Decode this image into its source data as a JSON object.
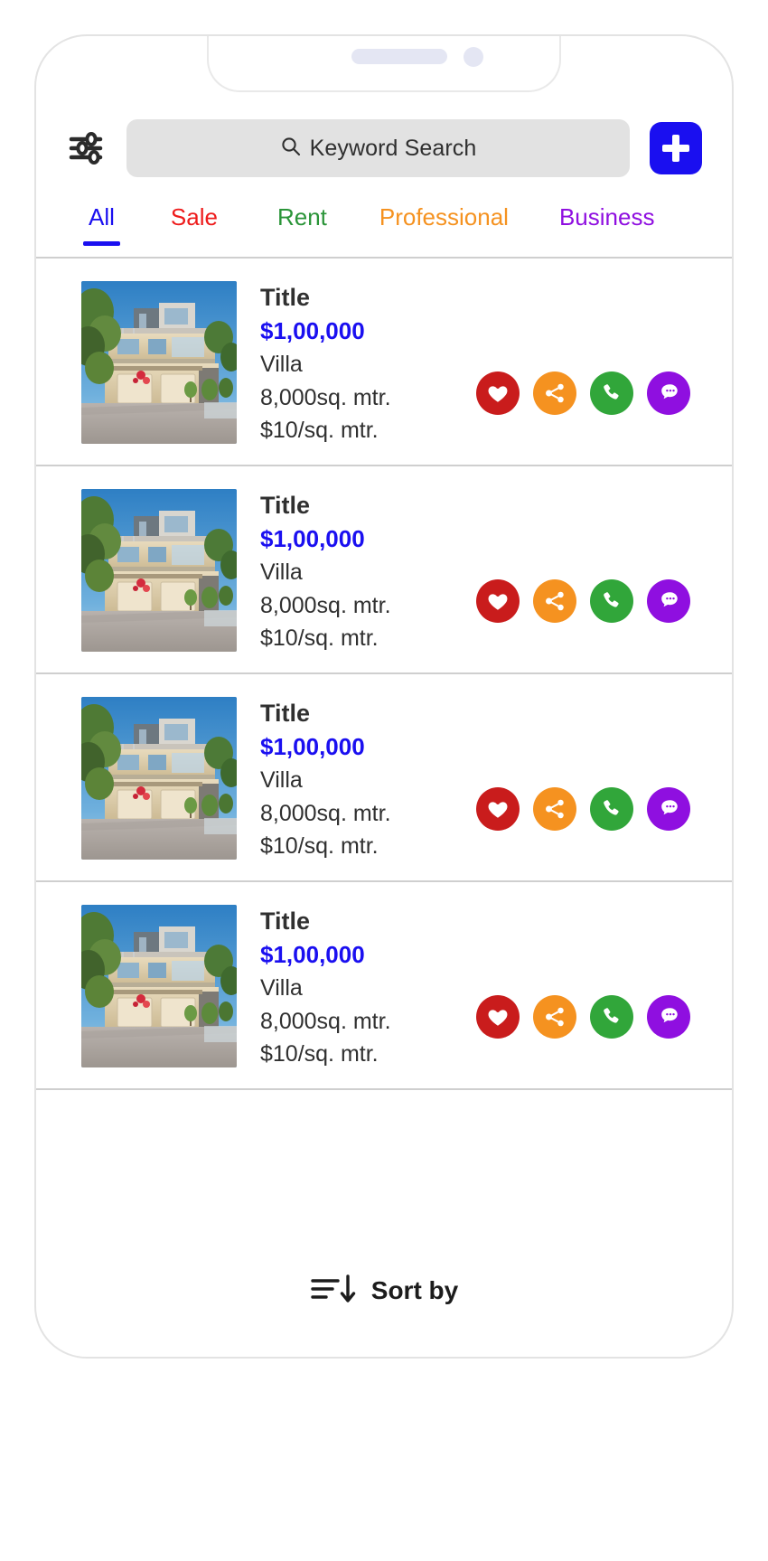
{
  "app": {
    "accent_blue": "#1a0ff0",
    "search_bg": "#e2e2e2"
  },
  "header": {
    "filter_icon": "sliders-filter-icon",
    "add_icon": "plus-icon",
    "search": {
      "icon": "search-icon",
      "placeholder": "Keyword Search",
      "value": ""
    }
  },
  "tabs": [
    {
      "label": "All",
      "color": "#1a0ff0",
      "active": true
    },
    {
      "label": "Sale",
      "color": "#ee1c1c",
      "active": false
    },
    {
      "label": "Rent",
      "color": "#2a9438",
      "active": false
    },
    {
      "label": "Professional",
      "color": "#f59220",
      "active": false
    },
    {
      "label": "Business",
      "color": "#8f0fe0",
      "active": false
    }
  ],
  "listings": [
    {
      "title": "Title",
      "price": "$1,00,000",
      "type": "Villa",
      "area": "8,000sq. mtr.",
      "rate": "$10/sq. mtr.",
      "image_alt": "modern hillside villa"
    },
    {
      "title": "Title",
      "price": "$1,00,000",
      "type": "Villa",
      "area": "8,000sq. mtr.",
      "rate": "$10/sq. mtr.",
      "image_alt": "modern hillside villa"
    },
    {
      "title": "Title",
      "price": "$1,00,000",
      "type": "Villa",
      "area": "8,000sq. mtr.",
      "rate": "$10/sq. mtr.",
      "image_alt": "modern hillside villa"
    },
    {
      "title": "Title",
      "price": "$1,00,000",
      "type": "Villa",
      "area": "8,000sq. mtr.",
      "rate": "$10/sq. mtr.",
      "image_alt": "modern hillside villa"
    }
  ],
  "actions": [
    {
      "name": "favorite",
      "icon": "heart-icon",
      "color": "#c91c1c"
    },
    {
      "name": "share",
      "icon": "share-icon",
      "color": "#f59220"
    },
    {
      "name": "call",
      "icon": "phone-icon",
      "color": "#31a63a"
    },
    {
      "name": "chat",
      "icon": "chat-icon",
      "color": "#8f0fe0"
    }
  ],
  "footer": {
    "sort_icon": "sort-descending-icon",
    "sort_label": "Sort by"
  }
}
